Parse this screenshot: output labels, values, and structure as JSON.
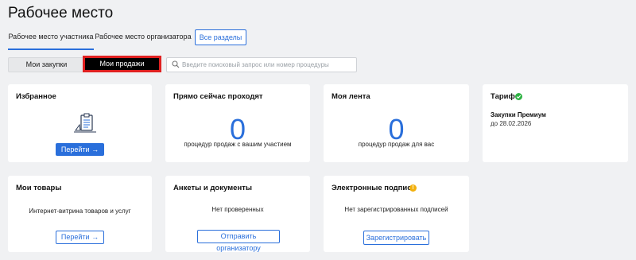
{
  "page": {
    "title": "Рабочее место"
  },
  "tabs": {
    "participant": "Рабочее место участника",
    "organizer": "Рабочее место организатора",
    "all_sections": "Все разделы"
  },
  "segments": {
    "purchases": "Мои закупки",
    "sales": "Мои продажи"
  },
  "search": {
    "placeholder": "Введите поисковый запрос или номер процедуры",
    "value": ""
  },
  "cards": {
    "favorites": {
      "title": "Избранное",
      "button": "Перейти →"
    },
    "live": {
      "title": "Прямо сейчас проходят",
      "count": "0",
      "caption": "процедур продаж с вашим участием"
    },
    "feed": {
      "title": "Моя лента",
      "count": "0",
      "caption": "процедур продаж для вас"
    },
    "tariff": {
      "title": "Тариф",
      "plan": "Закупки Премиум",
      "until": "до 28.02.2026"
    },
    "goods": {
      "title": "Мои товары",
      "text": "Интернет-витрина товаров и услуг",
      "button": "Перейти →"
    },
    "forms": {
      "title": "Анкеты и документы",
      "text": "Нет проверенных",
      "button": "Отправить организатору"
    },
    "signatures": {
      "title": "Электронные подписи",
      "text": "Нет зарегистрированных подписей",
      "button": "Зарегистрировать"
    }
  },
  "colors": {
    "accent": "#2a6fdb",
    "success": "#2fb344",
    "warning": "#f2b00d",
    "highlight": "#e02020"
  },
  "icons": [
    "search-icon",
    "clipboard-icon",
    "check-circle-icon",
    "warning-icon"
  ]
}
